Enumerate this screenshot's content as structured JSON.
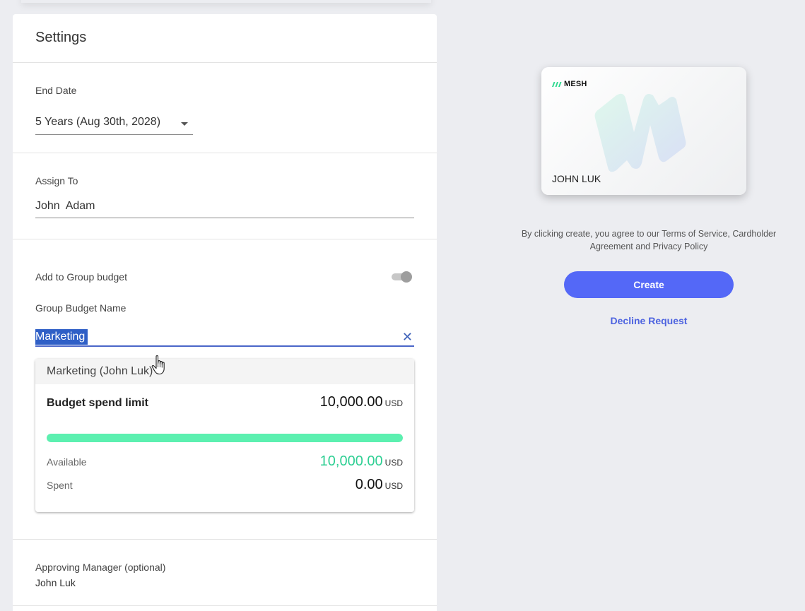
{
  "settings": {
    "title": "Settings",
    "end_date": {
      "label": "End Date",
      "value": "5 Years (Aug 30th, 2028)"
    },
    "assign_to": {
      "label": "Assign To",
      "value": "John  Adam"
    },
    "group_budget": {
      "toggle_label": "Add to Group budget",
      "toggle_on": true,
      "name_label": "Group Budget Name",
      "input_value": "Marketing",
      "clear_icon": "close-icon",
      "dropdown": {
        "option": "Marketing (John Luk)",
        "limit_label": "Budget spend limit",
        "limit_amount": "10,000.00",
        "available_label": "Available",
        "available_amount": "10,000.00",
        "spent_label": "Spent",
        "spent_amount": "0.00",
        "currency": "USD",
        "available_fraction": 1.0,
        "bar_color": "#5cf0b0"
      }
    },
    "approving_manager": {
      "label": "Approving Manager (optional)",
      "value": "John Luk"
    }
  },
  "card": {
    "brand": "MESH",
    "holder": "JOHN LUK"
  },
  "terms_text": "By clicking create, you agree to our Terms of Service, Cardholder Agreement and Privacy Policy",
  "actions": {
    "create_label": "Create",
    "decline_label": "Decline Request",
    "accent": "#5468f7"
  }
}
